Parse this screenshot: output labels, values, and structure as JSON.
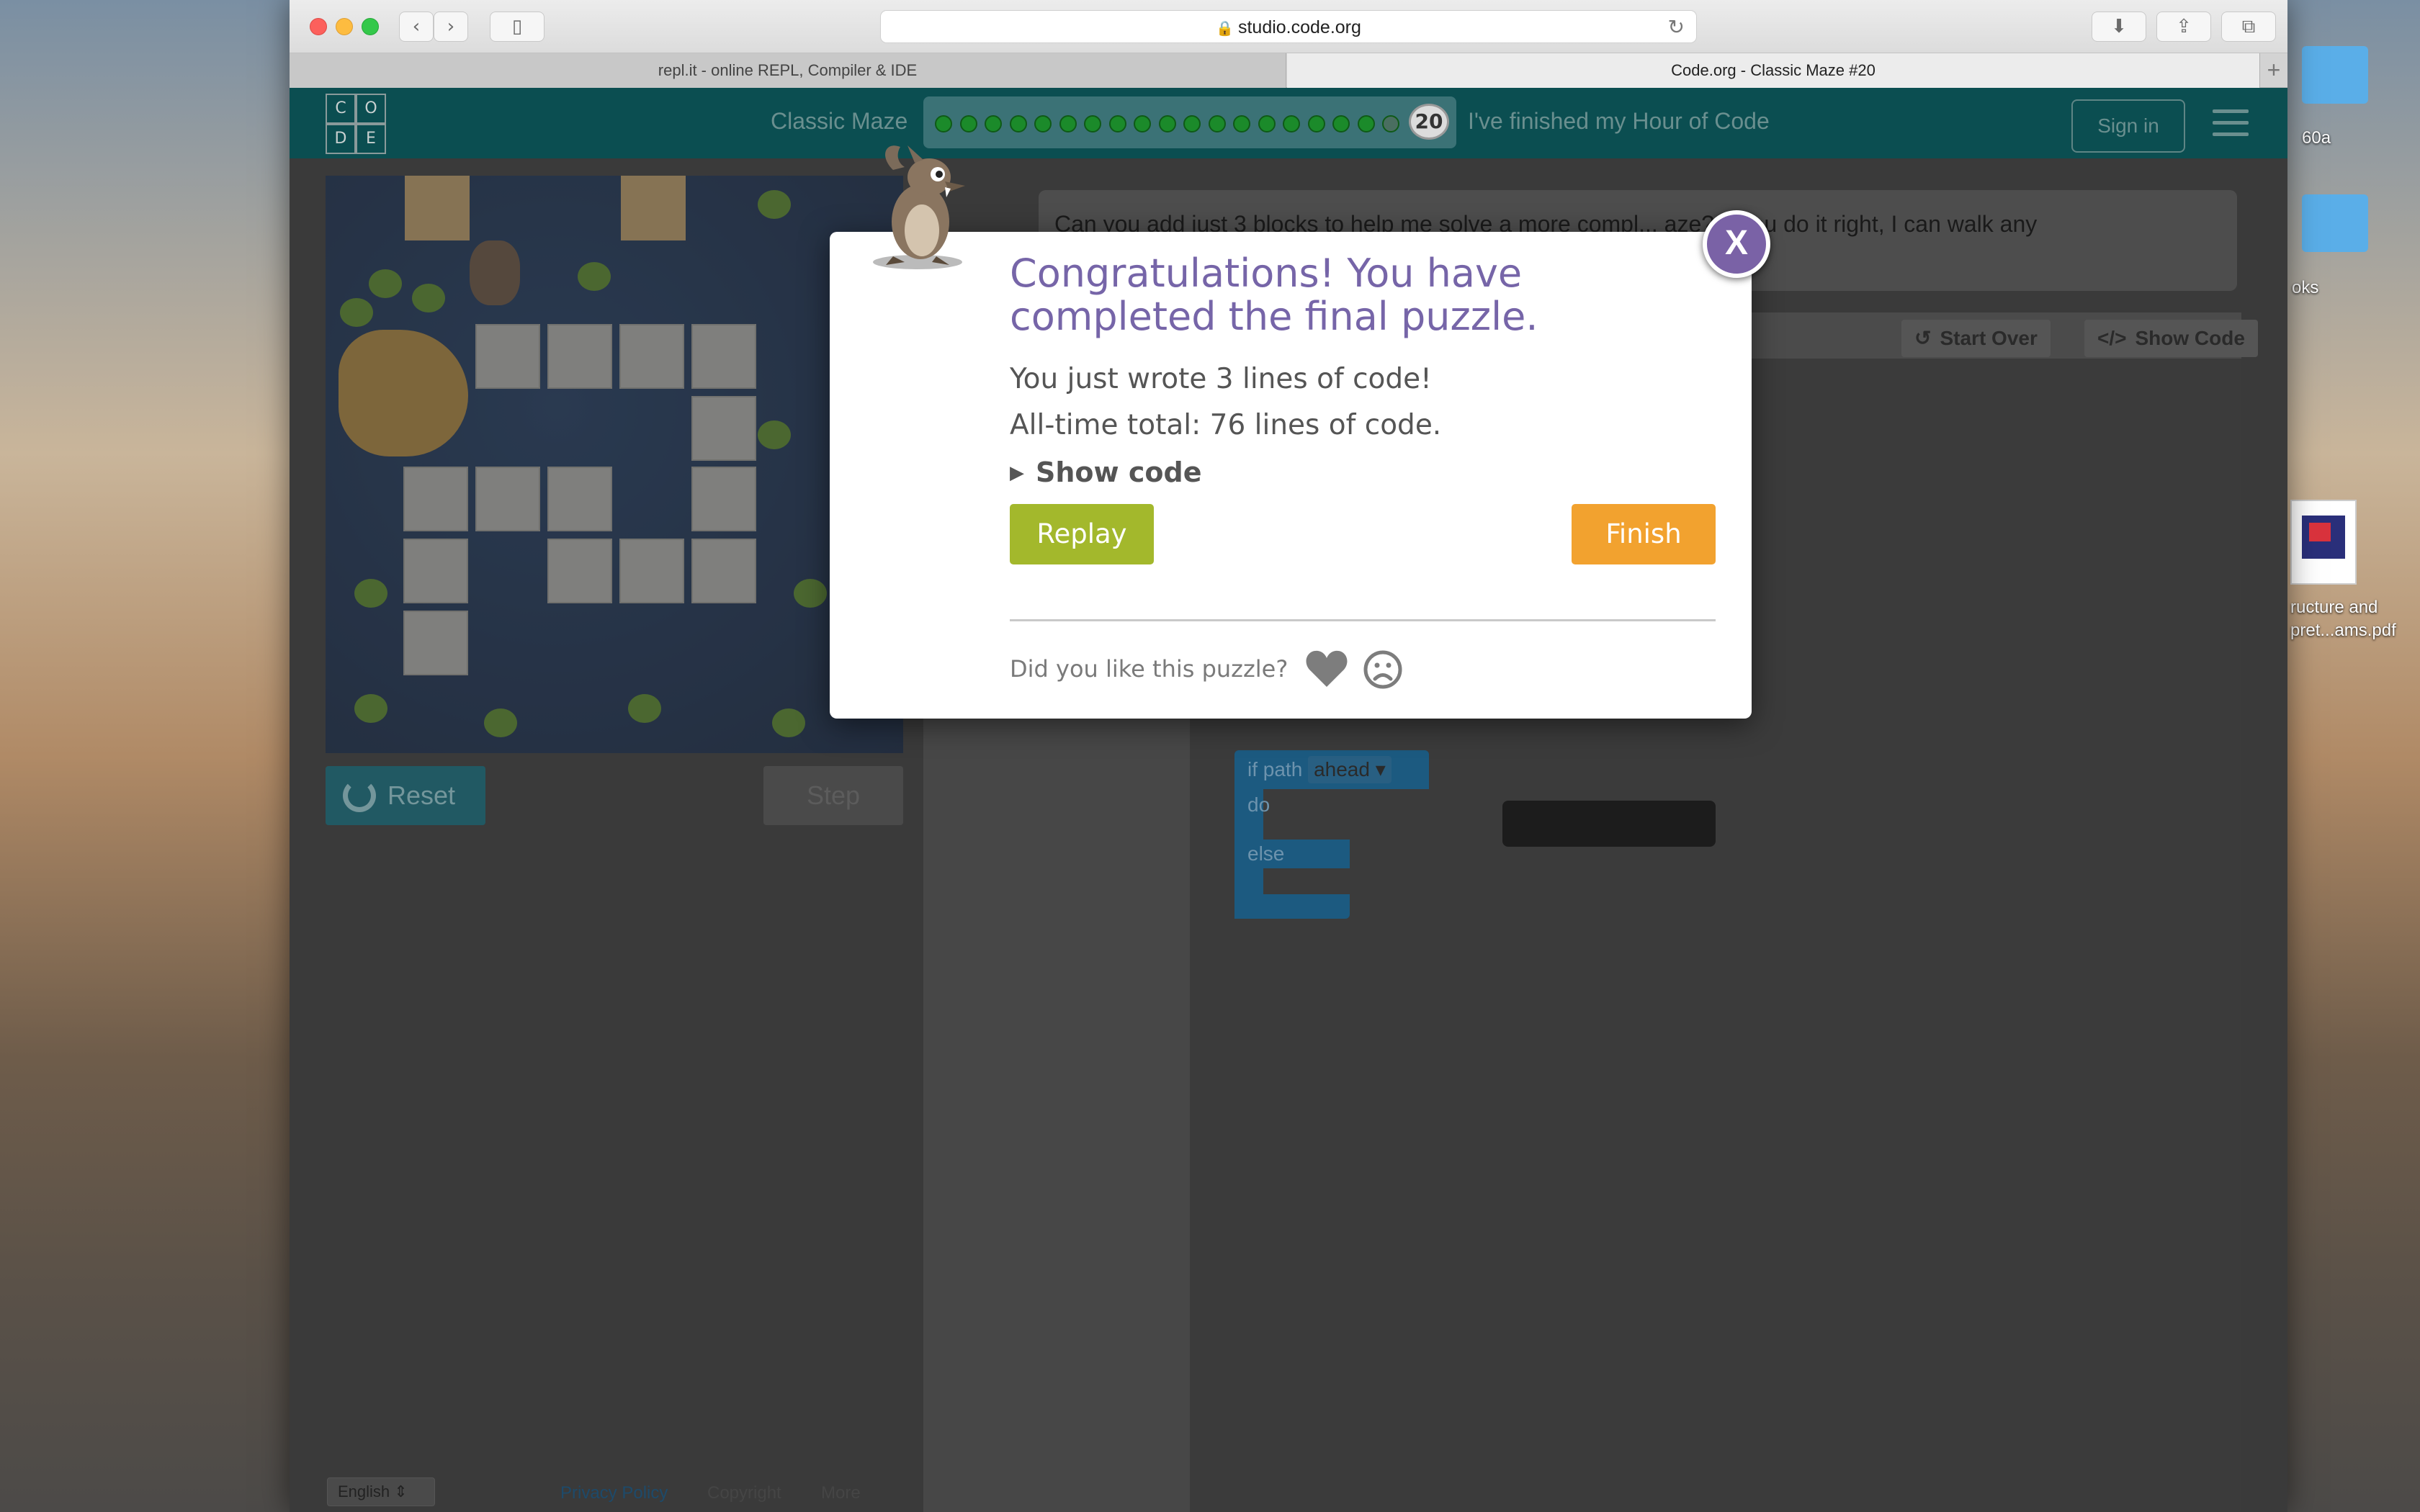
{
  "browser": {
    "url": "studio.code.org",
    "tabs": [
      {
        "label": "repl.it - online REPL, Compiler & IDE"
      },
      {
        "label": "Code.org - Classic Maze #20"
      }
    ]
  },
  "desktop": {
    "labels": [
      "60a",
      "oks",
      "ructure and",
      "pret...ams.pdf"
    ]
  },
  "header": {
    "logo_letters": [
      "C",
      "O",
      "D",
      "E"
    ],
    "level_title": "Classic Maze",
    "current_level": "20",
    "levels_completed": 19,
    "levels_total": 20,
    "hour_of_code_link": "I've finished my Hour of Code",
    "sign_in": "Sign in"
  },
  "maze_controls": {
    "reset": "Reset",
    "step": "Step"
  },
  "instructions": {
    "text": "Can you add just 3 blocks to help me solve a more compl... aze? If you do it right, I can walk any"
  },
  "workspace": {
    "start_over": "Start Over",
    "show_code": "Show Code",
    "block_if": "if path",
    "block_dir": "ahead",
    "block_do": "do",
    "block_else": "else"
  },
  "footer": {
    "language": "English",
    "links": [
      "Privacy Policy",
      "Copyright",
      "More"
    ]
  },
  "dialog": {
    "title": "Congratulations! You have completed the final puzzle.",
    "lines_written": "You just wrote 3 lines of code!",
    "total": "All-time total: 76 lines of code.",
    "show_code": "Show code",
    "replay": "Replay",
    "finish": "Finish",
    "feedback_prompt": "Did you like this puzzle?",
    "close": "X"
  },
  "colors": {
    "header": "#0b4e51",
    "dialog_title": "#7665a8",
    "replay": "#a3b82c",
    "finish": "#f2a22f",
    "close": "#7a62a6"
  }
}
